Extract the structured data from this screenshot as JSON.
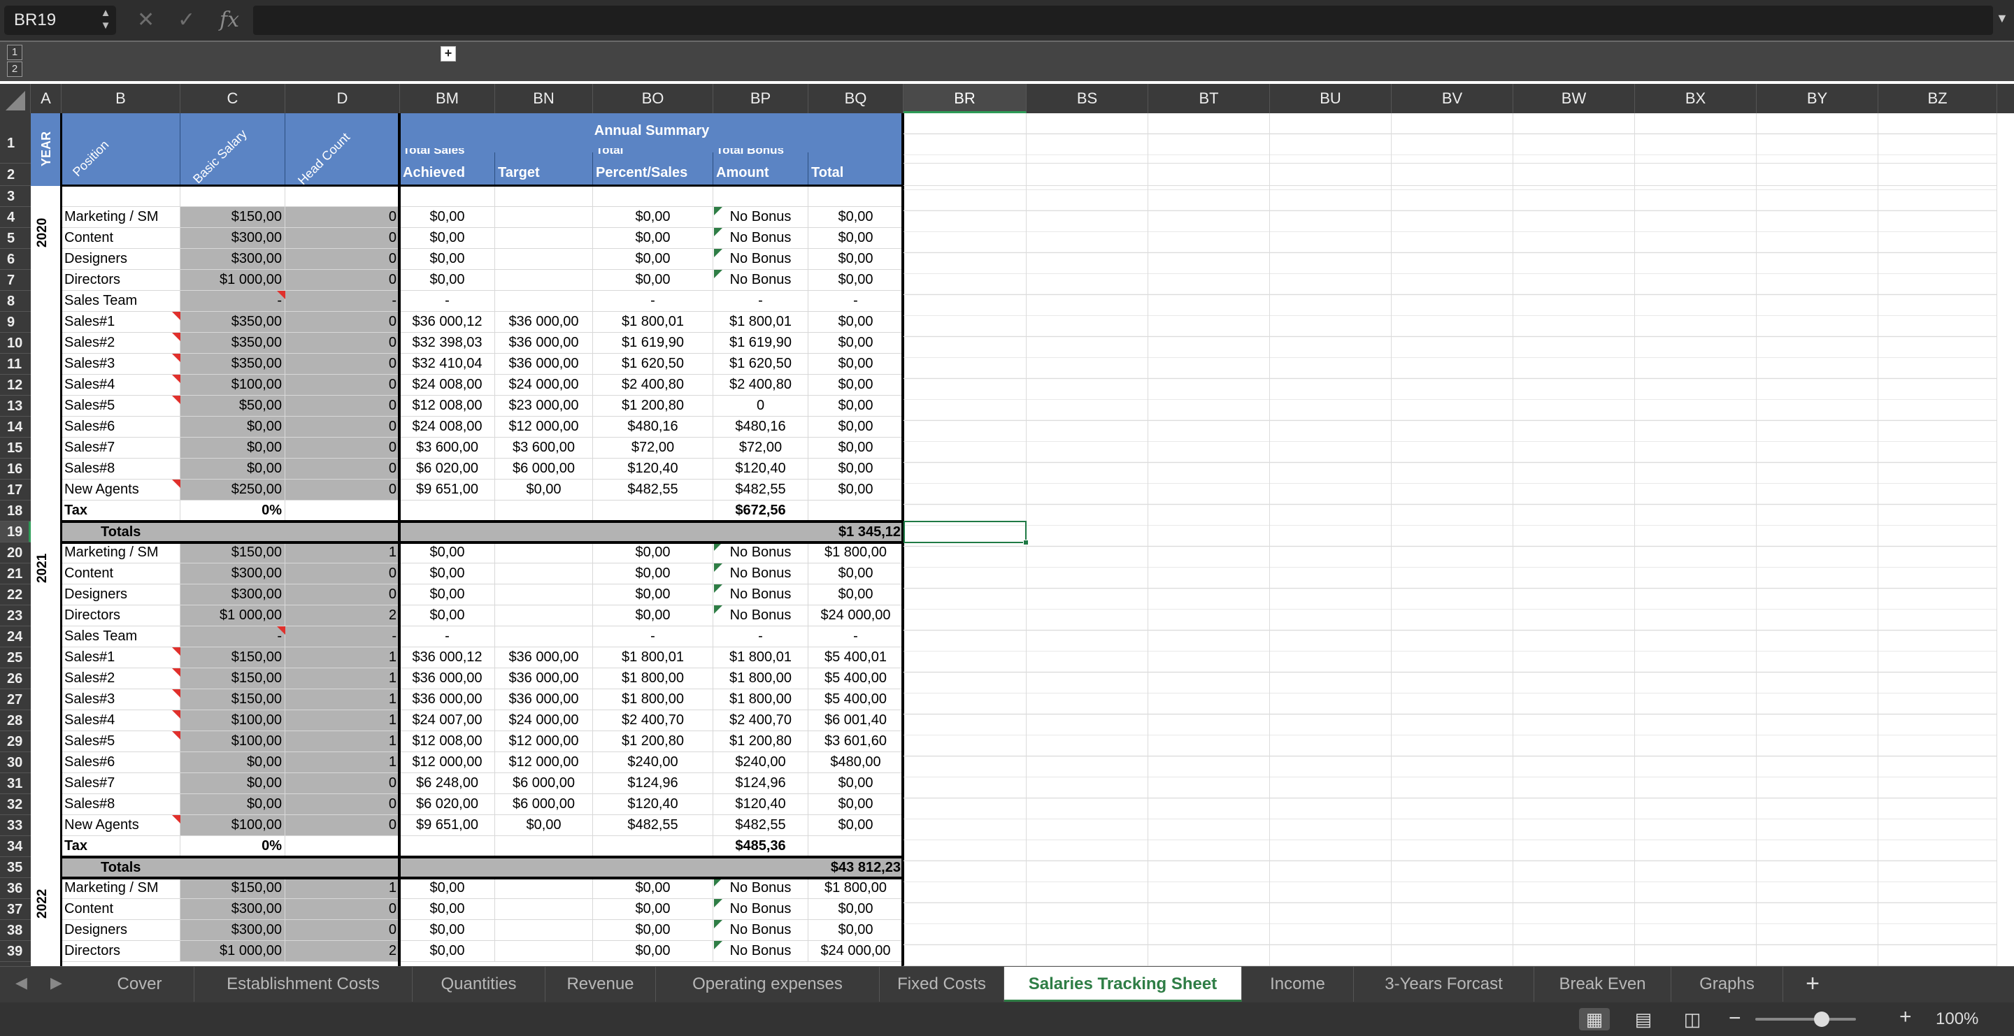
{
  "formula_bar": {
    "name_box": "BR19",
    "cancel_icon": "✕",
    "enter_icon": "✓",
    "fx_label": "fx",
    "formula_value": ""
  },
  "outline": {
    "level1": "1",
    "level2": "2",
    "group_toggle": "+"
  },
  "columns": [
    "A",
    "B",
    "C",
    "D",
    "BM",
    "BN",
    "BO",
    "BP",
    "BQ",
    "BR",
    "BS",
    "BT",
    "BU",
    "BV",
    "BW",
    "BX",
    "BY",
    "BZ"
  ],
  "selected_column": "BR",
  "selected_row": "19",
  "rows": [
    "1",
    "2",
    "3",
    "4",
    "5",
    "6",
    "7",
    "8",
    "9",
    "10",
    "11",
    "12",
    "13",
    "14",
    "15",
    "16",
    "17",
    "18",
    "19",
    "20",
    "21",
    "22",
    "23",
    "24",
    "25",
    "26",
    "27",
    "28",
    "29",
    "30",
    "31",
    "32",
    "33",
    "34",
    "35",
    "36",
    "37",
    "38",
    "39"
  ],
  "header": {
    "year": "YEAR",
    "position": "Position",
    "basic_salary": "Basic Salary",
    "head_count": "Head Count",
    "annual_summary": "Annual Summary",
    "total_sales_top": "Total Sales",
    "achieved": "Achieved",
    "target": "Target",
    "total_top": "Total",
    "percent_sales": "Percent/Sales",
    "total_bonus_top": "Total Bonus",
    "amount": "Amount",
    "total": "Total"
  },
  "year_labels": [
    "2020",
    "2021",
    "2022"
  ],
  "block_2020": [
    {
      "b": "Marketing / SM",
      "c": "$150,00",
      "d": "0",
      "bm": "$0,00",
      "bn": "",
      "bo": "$0,00",
      "bp": "No Bonus",
      "bq": "$0,00"
    },
    {
      "b": "Content",
      "c": "$300,00",
      "d": "0",
      "bm": "$0,00",
      "bn": "",
      "bo": "$0,00",
      "bp": "No Bonus",
      "bq": "$0,00"
    },
    {
      "b": "Designers",
      "c": "$300,00",
      "d": "0",
      "bm": "$0,00",
      "bn": "",
      "bo": "$0,00",
      "bp": "No Bonus",
      "bq": "$0,00"
    },
    {
      "b": "Directors",
      "c": "$1 000,00",
      "d": "0",
      "bm": "$0,00",
      "bn": "",
      "bo": "$0,00",
      "bp": "No Bonus",
      "bq": "$0,00"
    },
    {
      "b": "Sales Team",
      "c": "-",
      "d": "-",
      "bm": "-",
      "bn": "",
      "bo": "-",
      "bp": "-",
      "bq": "-"
    },
    {
      "b": "Sales#1",
      "c": "$350,00",
      "d": "0",
      "bm": "$36 000,12",
      "bn": "$36 000,00",
      "bo": "$1 800,01",
      "bp": "$1 800,01",
      "bq": "$0,00"
    },
    {
      "b": "Sales#2",
      "c": "$350,00",
      "d": "0",
      "bm": "$32 398,03",
      "bn": "$36 000,00",
      "bo": "$1 619,90",
      "bp": "$1 619,90",
      "bq": "$0,00"
    },
    {
      "b": "Sales#3",
      "c": "$350,00",
      "d": "0",
      "bm": "$32 410,04",
      "bn": "$36 000,00",
      "bo": "$1 620,50",
      "bp": "$1 620,50",
      "bq": "$0,00"
    },
    {
      "b": "Sales#4",
      "c": "$100,00",
      "d": "0",
      "bm": "$24 008,00",
      "bn": "$24 000,00",
      "bo": "$2 400,80",
      "bp": "$2 400,80",
      "bq": "$0,00"
    },
    {
      "b": "Sales#5",
      "c": "$50,00",
      "d": "0",
      "bm": "$12 008,00",
      "bn": "$23 000,00",
      "bo": "$1 200,80",
      "bp": "0",
      "bq": "$0,00"
    },
    {
      "b": "Sales#6",
      "c": "$0,00",
      "d": "0",
      "bm": "$24 008,00",
      "bn": "$12 000,00",
      "bo": "$480,16",
      "bp": "$480,16",
      "bq": "$0,00"
    },
    {
      "b": "Sales#7",
      "c": "$0,00",
      "d": "0",
      "bm": "$3 600,00",
      "bn": "$3 600,00",
      "bo": "$72,00",
      "bp": "$72,00",
      "bq": "$0,00"
    },
    {
      "b": "Sales#8",
      "c": "$0,00",
      "d": "0",
      "bm": "$6 020,00",
      "bn": "$6 000,00",
      "bo": "$120,40",
      "bp": "$120,40",
      "bq": "$0,00"
    },
    {
      "b": "New Agents",
      "c": "$250,00",
      "d": "0",
      "bm": "$9 651,00",
      "bn": "$0,00",
      "bo": "$482,55",
      "bp": "$482,55",
      "bq": "$0,00"
    }
  ],
  "tax_2020": {
    "label": "Tax",
    "pct": "0%",
    "bp": "$672,56"
  },
  "totals_2020": {
    "label": "Totals",
    "bq": "$1 345,12"
  },
  "block_2021": [
    {
      "b": "Marketing / SM",
      "c": "$150,00",
      "d": "1",
      "bm": "$0,00",
      "bn": "",
      "bo": "$0,00",
      "bp": "No Bonus",
      "bq": "$1 800,00"
    },
    {
      "b": "Content",
      "c": "$300,00",
      "d": "0",
      "bm": "$0,00",
      "bn": "",
      "bo": "$0,00",
      "bp": "No Bonus",
      "bq": "$0,00"
    },
    {
      "b": "Designers",
      "c": "$300,00",
      "d": "0",
      "bm": "$0,00",
      "bn": "",
      "bo": "$0,00",
      "bp": "No Bonus",
      "bq": "$0,00"
    },
    {
      "b": "Directors",
      "c": "$1 000,00",
      "d": "2",
      "bm": "$0,00",
      "bn": "",
      "bo": "$0,00",
      "bp": "No Bonus",
      "bq": "$24 000,00"
    },
    {
      "b": "Sales Team",
      "c": "-",
      "d": "-",
      "bm": "-",
      "bn": "",
      "bo": "-",
      "bp": "-",
      "bq": "-"
    },
    {
      "b": "Sales#1",
      "c": "$150,00",
      "d": "1",
      "bm": "$36 000,12",
      "bn": "$36 000,00",
      "bo": "$1 800,01",
      "bp": "$1 800,01",
      "bq": "$5 400,01"
    },
    {
      "b": "Sales#2",
      "c": "$150,00",
      "d": "1",
      "bm": "$36 000,00",
      "bn": "$36 000,00",
      "bo": "$1 800,00",
      "bp": "$1 800,00",
      "bq": "$5 400,00"
    },
    {
      "b": "Sales#3",
      "c": "$150,00",
      "d": "1",
      "bm": "$36 000,00",
      "bn": "$36 000,00",
      "bo": "$1 800,00",
      "bp": "$1 800,00",
      "bq": "$5 400,00"
    },
    {
      "b": "Sales#4",
      "c": "$100,00",
      "d": "1",
      "bm": "$24 007,00",
      "bn": "$24 000,00",
      "bo": "$2 400,70",
      "bp": "$2 400,70",
      "bq": "$6 001,40"
    },
    {
      "b": "Sales#5",
      "c": "$100,00",
      "d": "1",
      "bm": "$12 008,00",
      "bn": "$12 000,00",
      "bo": "$1 200,80",
      "bp": "$1 200,80",
      "bq": "$3 601,60"
    },
    {
      "b": "Sales#6",
      "c": "$0,00",
      "d": "1",
      "bm": "$12 000,00",
      "bn": "$12 000,00",
      "bo": "$240,00",
      "bp": "$240,00",
      "bq": "$480,00"
    },
    {
      "b": "Sales#7",
      "c": "$0,00",
      "d": "0",
      "bm": "$6 248,00",
      "bn": "$6 000,00",
      "bo": "$124,96",
      "bp": "$124,96",
      "bq": "$0,00"
    },
    {
      "b": "Sales#8",
      "c": "$0,00",
      "d": "0",
      "bm": "$6 020,00",
      "bn": "$6 000,00",
      "bo": "$120,40",
      "bp": "$120,40",
      "bq": "$0,00"
    },
    {
      "b": "New Agents",
      "c": "$100,00",
      "d": "0",
      "bm": "$9 651,00",
      "bn": "$0,00",
      "bo": "$482,55",
      "bp": "$482,55",
      "bq": "$0,00"
    }
  ],
  "tax_2021": {
    "label": "Tax",
    "pct": "0%",
    "bp": "$485,36"
  },
  "totals_2021": {
    "label": "Totals",
    "bq": "$43 812,23"
  },
  "block_2022": [
    {
      "b": "Marketing / SM",
      "c": "$150,00",
      "d": "1",
      "bm": "$0,00",
      "bn": "",
      "bo": "$0,00",
      "bp": "No Bonus",
      "bq": "$1 800,00"
    },
    {
      "b": "Content",
      "c": "$300,00",
      "d": "0",
      "bm": "$0,00",
      "bn": "",
      "bo": "$0,00",
      "bp": "No Bonus",
      "bq": "$0,00"
    },
    {
      "b": "Designers",
      "c": "$300,00",
      "d": "0",
      "bm": "$0,00",
      "bn": "",
      "bo": "$0,00",
      "bp": "No Bonus",
      "bq": "$0,00"
    },
    {
      "b": "Directors",
      "c": "$1 000,00",
      "d": "2",
      "bm": "$0,00",
      "bn": "",
      "bo": "$0,00",
      "bp": "No Bonus",
      "bq": "$24 000,00"
    }
  ],
  "sheet_tabs": [
    "Cover",
    "Establishment  Costs",
    "Quantities",
    "Revenue",
    "Operating expenses",
    "Fixed Costs",
    "Salaries Tracking Sheet",
    "Income",
    "3-Years Forcast",
    "Break Even",
    "Graphs"
  ],
  "active_tab": "Salaries Tracking Sheet",
  "status_bar": {
    "zoom": "100%",
    "zoom_level_percent": 100
  },
  "colors": {
    "header_blue": "#5b84c4",
    "gray_cell": "#b3b3b3",
    "selection_green": "#1f7a45",
    "comment_red": "#e0302c",
    "note_green": "#2e7d45"
  }
}
